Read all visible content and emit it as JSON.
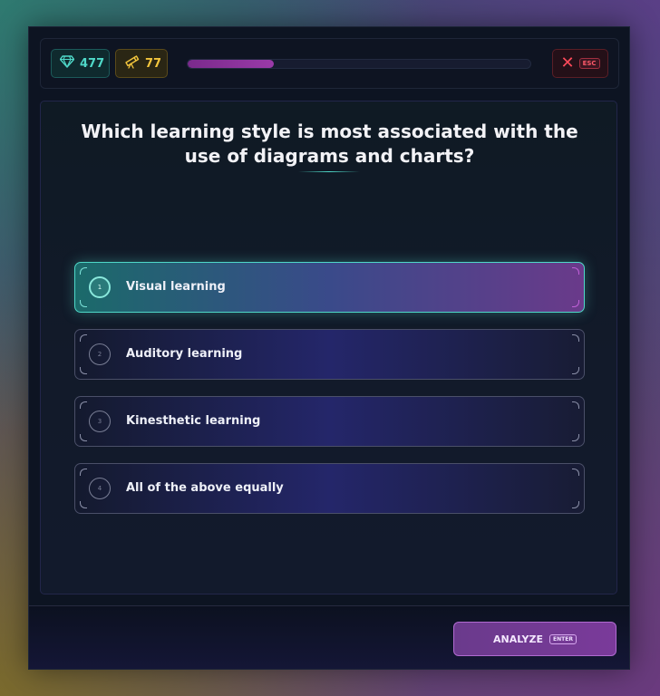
{
  "topbar": {
    "gems": {
      "icon": "diamond-icon",
      "count": "477",
      "color": "#4fd8c8"
    },
    "telescope": {
      "icon": "telescope-icon",
      "count": "77",
      "color": "#f2c53d"
    },
    "progress": {
      "fraction": 0.25,
      "color": "#8a30a0"
    },
    "close": {
      "icon": "close-icon",
      "hint": "ESC"
    }
  },
  "question": {
    "text": "Which learning style is most associated with the use of diagrams and charts?"
  },
  "options": [
    {
      "number": "1",
      "label": "Visual learning",
      "selected": true
    },
    {
      "number": "2",
      "label": "Auditory learning",
      "selected": false
    },
    {
      "number": "3",
      "label": "Kinesthetic learning",
      "selected": false
    },
    {
      "number": "4",
      "label": "All of the above equally",
      "selected": false
    }
  ],
  "footer": {
    "analyze_label": "ANALYZE",
    "analyze_hint": "ENTER"
  }
}
